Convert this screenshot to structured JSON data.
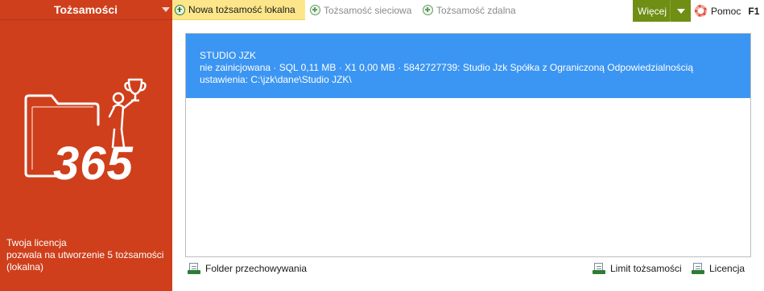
{
  "sidebar": {
    "title": "Tożsamości",
    "logo_text": "365",
    "license_text": "Twoja licencja\npozwala na utworzenie 5 tożsamości\n(lokalna)",
    "license_lines": [
      "Twoja licencja",
      "pozwala na utworzenie 5 tożsamości",
      "(lokalna)"
    ],
    "colors": {
      "background": "#cf3f1c",
      "accent": "#ffffff"
    }
  },
  "toolbar": {
    "new_local": "Nowa tożsamość lokalna",
    "network": "Tożsamość sieciowa",
    "remote": "Tożsamość zdalna",
    "more": "Więcej",
    "help": "Pomoc",
    "help_key": "F1",
    "icons": {
      "new": "add-circle-icon",
      "help": "lifebuoy-icon",
      "more": "chevron-down-icon"
    }
  },
  "identities": [
    {
      "name": "STUDIO JZK",
      "details": "nie zainicjowana · SQL 0,11 MB · X1 0,00 MB · 5842727739: Studio Jzk Spółka z Ograniczoną Odpowiedzialnością",
      "settings": "ustawienia: C:\\jzk\\dane\\Studio JZK\\",
      "selected": true
    }
  ],
  "bottom": {
    "storage_folder": "Folder przechowywania",
    "identity_limit": "Limit tożsamości",
    "license": "Licencja",
    "icon": "certificate-icon"
  },
  "colors": {
    "selection": "#3b95f2",
    "active_button": "#fde68a",
    "more_button": "#6f8e14"
  }
}
